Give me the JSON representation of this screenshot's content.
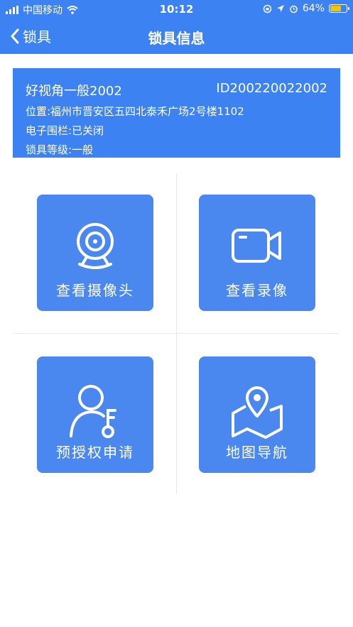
{
  "status_bar": {
    "carrier": "中国移动",
    "time": "10:12",
    "battery": "64%"
  },
  "nav": {
    "back_label": "锁具",
    "title": "锁具信息"
  },
  "lock": {
    "name": "好视角一般2002",
    "id": "ID200220022002",
    "location": "位置:福州市晋安区五四北泰禾广场2号楼1102",
    "fence": "电子围栏:已关闭",
    "level": "锁具等级:一般"
  },
  "actions": {
    "camera": "查看摄像头",
    "video": "查看录像",
    "preauth": "预授权申请",
    "navigation": "地图导航"
  },
  "colors": {
    "primary": "#3d82f2",
    "tile": "#4a88f0"
  }
}
